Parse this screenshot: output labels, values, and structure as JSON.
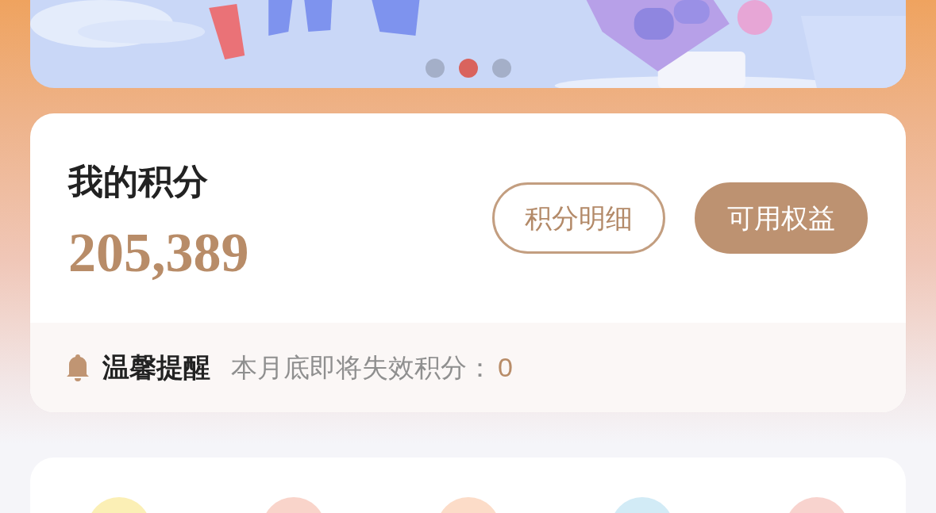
{
  "banner": {
    "dots": [
      {
        "selected": false
      },
      {
        "selected": true
      },
      {
        "selected": false
      }
    ]
  },
  "points_card": {
    "title": "我的积分",
    "balance": "205,389",
    "buttons": [
      {
        "label": "积分明细",
        "kind": "outline"
      },
      {
        "label": "可用权益",
        "kind": "filled"
      }
    ],
    "reminder": {
      "title": "温馨提醒",
      "text": "本月底即将失效积分：",
      "value": "0"
    }
  }
}
